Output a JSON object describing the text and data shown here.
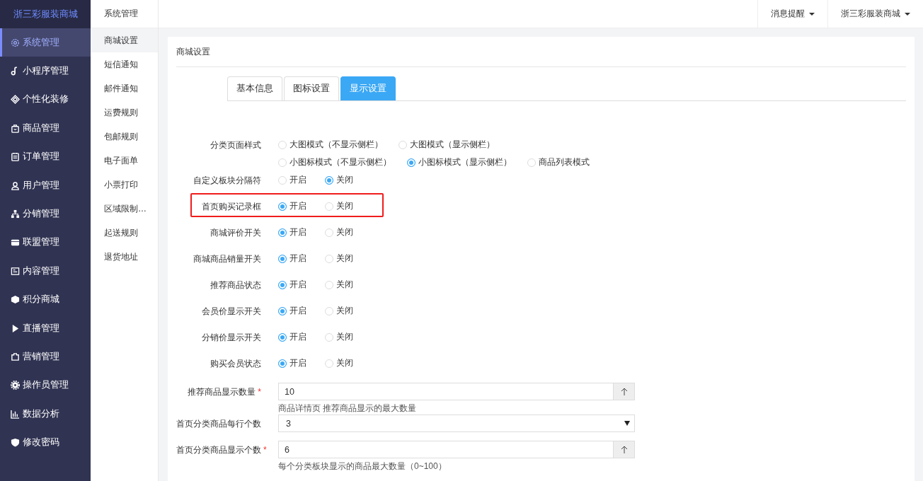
{
  "brand": "浙三彩服装商城",
  "sidebar": {
    "items": [
      {
        "label": "系统管理",
        "selected": true
      },
      {
        "label": "小程序管理",
        "selected": false
      },
      {
        "label": "个性化装修",
        "selected": false
      },
      {
        "label": "商品管理",
        "selected": false
      },
      {
        "label": "订单管理",
        "selected": false
      },
      {
        "label": "用户管理",
        "selected": false
      },
      {
        "label": "分销管理",
        "selected": false
      },
      {
        "label": "联盟管理",
        "selected": false
      },
      {
        "label": "内容管理",
        "selected": false
      },
      {
        "label": "积分商城",
        "selected": false
      },
      {
        "label": "直播管理",
        "selected": false
      },
      {
        "label": "营销管理",
        "selected": false
      },
      {
        "label": "操作员管理",
        "selected": false
      },
      {
        "label": "数据分析",
        "selected": false
      },
      {
        "label": "修改密码",
        "selected": false
      }
    ]
  },
  "subnav": {
    "title": "系统管理",
    "items": [
      {
        "label": "商城设置",
        "selected": true
      },
      {
        "label": "短信通知",
        "selected": false
      },
      {
        "label": "邮件通知",
        "selected": false
      },
      {
        "label": "运费规则",
        "selected": false
      },
      {
        "label": "包邮规则",
        "selected": false
      },
      {
        "label": "电子面单",
        "selected": false
      },
      {
        "label": "小票打印",
        "selected": false
      },
      {
        "label": "区域限制…",
        "selected": false
      },
      {
        "label": "起送规则",
        "selected": false
      },
      {
        "label": "退货地址",
        "selected": false
      }
    ]
  },
  "topbar": {
    "menus": [
      "消息提醒",
      "浙三彩服装商城"
    ]
  },
  "panel": {
    "title": "商城设置",
    "tabs": [
      {
        "label": "基本信息",
        "selected": false
      },
      {
        "label": "图标设置",
        "selected": false
      },
      {
        "label": "显示设置",
        "selected": true
      }
    ],
    "fields": [
      {
        "kind": "radio",
        "label": "分类页面样式",
        "highlighted": false,
        "lines": [
          [
            {
              "label": "大图模式（不显示侧栏）",
              "selected": false
            },
            {
              "label": "大图模式（显示侧栏）",
              "selected": false
            }
          ],
          [
            {
              "label": "小图标模式（不显示侧栏）",
              "selected": false
            },
            {
              "label": "小图标模式（显示侧栏）",
              "selected": true
            },
            {
              "label": "商品列表模式",
              "selected": false
            }
          ]
        ]
      },
      {
        "kind": "radio",
        "label": "自定义板块分隔符",
        "highlighted": false,
        "lines": [
          [
            {
              "label": "开启",
              "selected": false
            },
            {
              "label": "关闭",
              "selected": true
            }
          ]
        ]
      },
      {
        "kind": "radio",
        "label": "首页购买记录框",
        "highlighted": true,
        "lines": [
          [
            {
              "label": "开启",
              "selected": true
            },
            {
              "label": "关闭",
              "selected": false
            }
          ]
        ]
      },
      {
        "kind": "radio",
        "label": "商城评价开关",
        "highlighted": false,
        "lines": [
          [
            {
              "label": "开启",
              "selected": true
            },
            {
              "label": "关闭",
              "selected": false
            }
          ]
        ]
      },
      {
        "kind": "radio",
        "label": "商城商品销量开关",
        "highlighted": false,
        "lines": [
          [
            {
              "label": "开启",
              "selected": true
            },
            {
              "label": "关闭",
              "selected": false
            }
          ]
        ]
      },
      {
        "kind": "radio",
        "label": "推荐商品状态",
        "highlighted": false,
        "lines": [
          [
            {
              "label": "开启",
              "selected": true
            },
            {
              "label": "关闭",
              "selected": false
            }
          ]
        ]
      },
      {
        "kind": "radio",
        "label": "会员价显示开关",
        "highlighted": false,
        "lines": [
          [
            {
              "label": "开启",
              "selected": true
            },
            {
              "label": "关闭",
              "selected": false
            }
          ]
        ]
      },
      {
        "kind": "radio",
        "label": "分销价显示开关",
        "highlighted": false,
        "lines": [
          [
            {
              "label": "开启",
              "selected": true
            },
            {
              "label": "关闭",
              "selected": false
            }
          ]
        ]
      },
      {
        "kind": "radio",
        "label": "购买会员状态",
        "highlighted": false,
        "lines": [
          [
            {
              "label": "开启",
              "selected": true
            },
            {
              "label": "关闭",
              "selected": false
            }
          ]
        ]
      },
      {
        "kind": "number",
        "label": "推荐商品显示数量",
        "required_mark": "*",
        "value": "10",
        "hint": "商品详情页 推荐商品显示的最大数量"
      },
      {
        "kind": "select",
        "label": "首页分类商品每行个数",
        "value": "3"
      },
      {
        "kind": "number",
        "label": "首页分类商品显示个数",
        "required_mark": "*",
        "value": "6",
        "hint": "每个分类板块显示的商品最大数量（0~100）"
      }
    ]
  }
}
